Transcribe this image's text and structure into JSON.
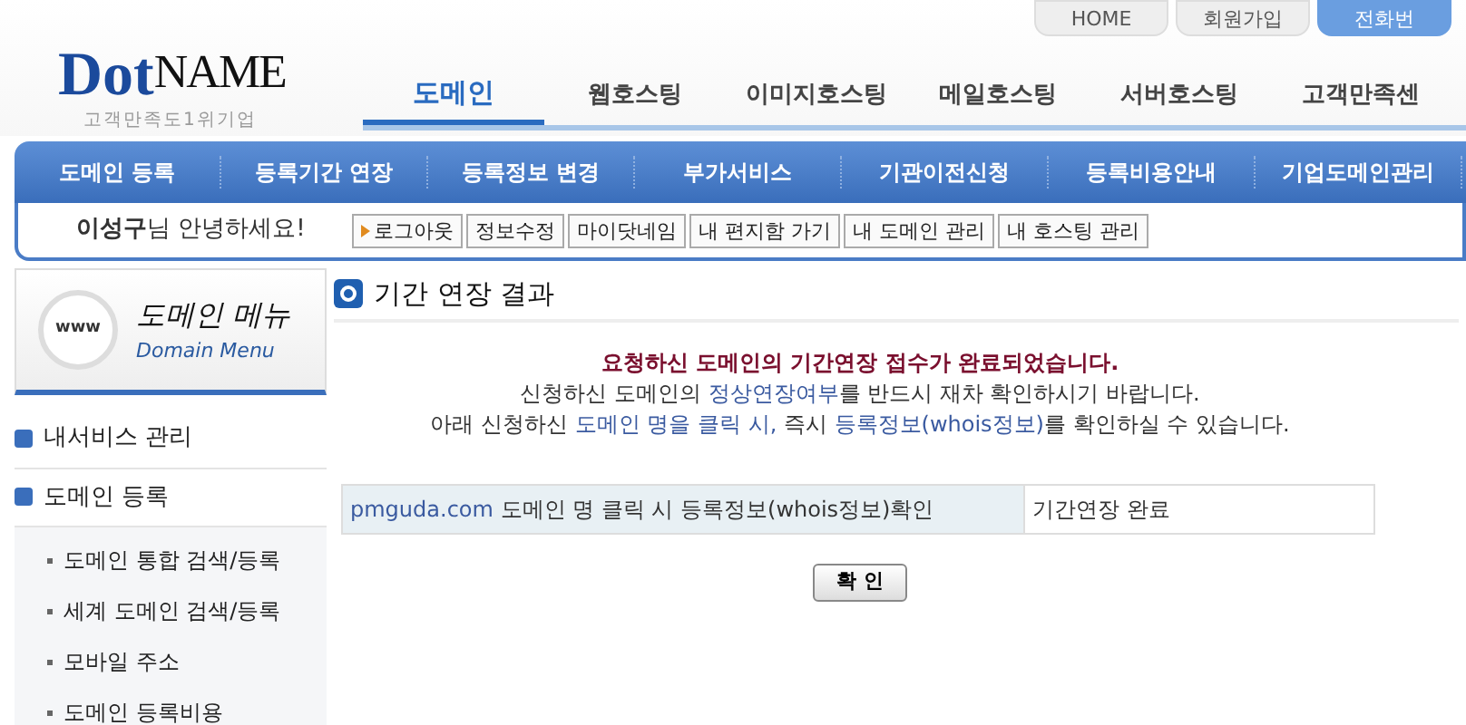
{
  "logo": {
    "brand_a": "Dot",
    "brand_b": "NAME",
    "slogan": "고객만족도1위기업"
  },
  "top_links": [
    {
      "label": "HOME",
      "selected": false
    },
    {
      "label": "회원가입",
      "selected": false
    },
    {
      "label": "전화번",
      "selected": true
    }
  ],
  "main_nav": [
    {
      "label": "도메인",
      "selected": true
    },
    {
      "label": "웹호스팅",
      "selected": false
    },
    {
      "label": "이미지호스팅",
      "selected": false
    },
    {
      "label": "메일호스팅",
      "selected": false
    },
    {
      "label": "서버호스팅",
      "selected": false
    },
    {
      "label": "고객만족센",
      "selected": false
    }
  ],
  "sub_nav": [
    "도메인 등록",
    "등록기간 연장",
    "등록정보 변경",
    "부가서비스",
    "기관이전신청",
    "등록비용안내",
    "기업도메인관리"
  ],
  "welcome": "**이성구**님 안녕하세요!",
  "user_buttons": [
    {
      "label": "로그아웃",
      "arrow": true
    },
    {
      "label": "정보수정",
      "arrow": false
    },
    {
      "label": "마이닷네임",
      "arrow": false
    },
    {
      "label": "내 편지함 가기",
      "arrow": false
    },
    {
      "label": "내 도메인 관리",
      "arrow": false
    },
    {
      "label": "내 호스팅 관리",
      "arrow": false
    }
  ],
  "sidebar": {
    "title": "도메인 메뉴",
    "subtitle": "Domain Menu",
    "badge": "www",
    "items": [
      {
        "label": "내서비스 관리"
      },
      {
        "label": "도메인 등록",
        "children": [
          {
            "label": "도메인 통합 검색/등록"
          },
          {
            "label": "세계 도메인 검색/등록"
          },
          {
            "label": "모바일 주소"
          },
          {
            "label": "도메인 등록비용"
          }
        ]
      }
    ]
  },
  "content": {
    "title": "기간 연장 결과",
    "headline": "요청하신 도메인의 기간연장 접수가 완료되었습니다.",
    "lines": [
      [
        {
          "text": "신청하신 도메인의 ",
          "kind": "text"
        },
        {
          "text": "정상연장여부",
          "kind": "link"
        },
        {
          "text": "를 반드시 재차 확인하시기 바랍니다.",
          "kind": "text"
        }
      ],
      [
        {
          "text": "아래 신청하신 ",
          "kind": "text"
        },
        {
          "text": "도메인 명을 클릭 시,",
          "kind": "link"
        },
        {
          "text": " 즉시 ",
          "kind": "text"
        },
        {
          "text": "등록정보(whois정보)",
          "kind": "link"
        },
        {
          "text": "를 확인하실 수 있습니다.",
          "kind": "text"
        }
      ]
    ],
    "result_row": {
      "domain": "pmguda.com",
      "note": "도메인 명 클릭 시 등록정보(whois정보)확인",
      "status": "기간연장 완료"
    },
    "confirm_button": "확 인"
  }
}
